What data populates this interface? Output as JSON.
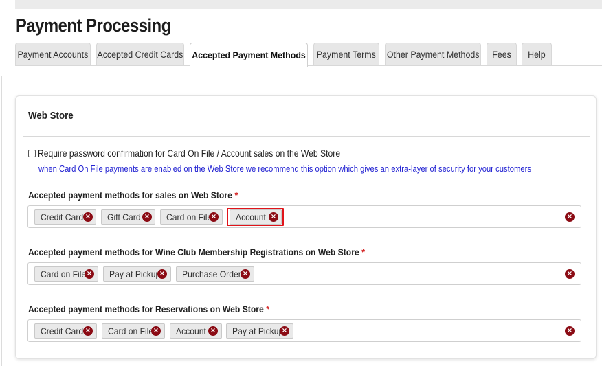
{
  "header": {
    "title": "Payment Processing",
    "topbar_text": ""
  },
  "tabs": [
    {
      "label": "Payment Accounts",
      "active": false
    },
    {
      "label": "Accepted Credit Cards",
      "active": false
    },
    {
      "label": "Accepted Payment Methods",
      "active": true
    },
    {
      "label": "Payment Terms",
      "active": false
    },
    {
      "label": "Other Payment Methods",
      "active": false
    },
    {
      "label": "Fees",
      "active": false
    },
    {
      "label": "Help",
      "active": false
    }
  ],
  "section": {
    "title": "Web Store",
    "require_password": {
      "label": "Require password confirmation for Card On File / Account sales on the Web Store",
      "checked": false,
      "hint": "when Card On File payments are enabled on the Web Store we recommend this option which gives an extra-layer of security for your customers"
    },
    "fields": [
      {
        "label": "Accepted payment methods for sales on Web Store",
        "required_mark": "*",
        "chips": [
          "Credit Card",
          "Gift Card",
          "Card on File",
          "Account"
        ],
        "highlighted_chip": "Account"
      },
      {
        "label": "Accepted payment methods for Wine Club Membership Registrations on Web Store",
        "required_mark": "*",
        "chips": [
          "Card on File",
          "Pay at Pickup",
          "Purchase Order"
        ]
      },
      {
        "label": "Accepted payment methods for Reservations on Web Store",
        "required_mark": "*",
        "chips": [
          "Credit Card",
          "Card on File",
          "Account",
          "Pay at Pickup"
        ]
      }
    ]
  },
  "icons": {
    "remove": "remove-circle-icon",
    "remove_glyph": "×"
  },
  "colors": {
    "remove_icon": "#8b0b14",
    "hint_text": "#2323d2",
    "required": "#d42222",
    "highlight": "#e0141a"
  }
}
